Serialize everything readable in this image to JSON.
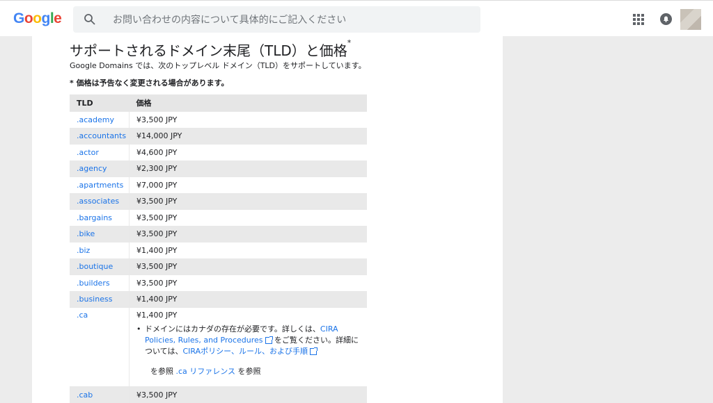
{
  "header": {
    "logo": [
      "G",
      "o",
      "o",
      "g",
      "l",
      "e"
    ],
    "logo_colors": [
      "#4285f4",
      "#ea4335",
      "#fbbc05",
      "#4285f4",
      "#34a853",
      "#ea4335"
    ],
    "search_placeholder": "お問い合わせの内容について具体的にご記入ください",
    "icons": [
      "search-icon",
      "apps-icon",
      "notifications-icon",
      "avatar"
    ]
  },
  "page": {
    "title": "サポートされるドメイン末尾（TLD）と価格",
    "title_mark": "*",
    "intro": "Google Domains では、次のトップレベル ドメイン（TLD）をサポートしています。",
    "note": "* 価格は予告なく変更される場合があります。"
  },
  "table": {
    "headers": [
      "TLD",
      "価格"
    ],
    "rows": [
      {
        "tld": ".academy",
        "price": "¥3,500 JPY"
      },
      {
        "tld": ".accountants",
        "price": "¥14,000 JPY"
      },
      {
        "tld": ".actor",
        "price": "¥4,600 JPY"
      },
      {
        "tld": ".agency",
        "price": "¥2,300 JPY"
      },
      {
        "tld": ".apartments",
        "price": "¥7,000 JPY"
      },
      {
        "tld": ".associates",
        "price": "¥3,500 JPY"
      },
      {
        "tld": ".bargains",
        "price": "¥3,500 JPY"
      },
      {
        "tld": ".bike",
        "price": "¥3,500 JPY"
      },
      {
        "tld": ".biz",
        "price": "¥1,400 JPY"
      },
      {
        "tld": ".boutique",
        "price": "¥3,500 JPY"
      },
      {
        "tld": ".builders",
        "price": "¥3,500 JPY"
      },
      {
        "tld": ".business",
        "price": "¥1,400 JPY"
      }
    ],
    "ca": {
      "tld": ".ca",
      "price": "¥1,400 JPY",
      "bullet_text1": "ドメインにはカナダの存在が必要です。詳しくは、",
      "bullet_link1": "CIRA Policies, Rules, and Procedures",
      "bullet_text2": " をご覧ください。詳細については、",
      "bullet_link2": "CIRAポリシー、ルール、および手順",
      "ref_prefix": "を参照 ",
      "ref_link": ".ca リファレンス",
      "ref_suffix": " を参照"
    },
    "last_row": {
      "tld": ".cab",
      "price": "¥3,500 JPY"
    }
  },
  "colors": {
    "link": "#1a73e8",
    "row_alt": "#e9e9e9",
    "background": "#ececec"
  }
}
